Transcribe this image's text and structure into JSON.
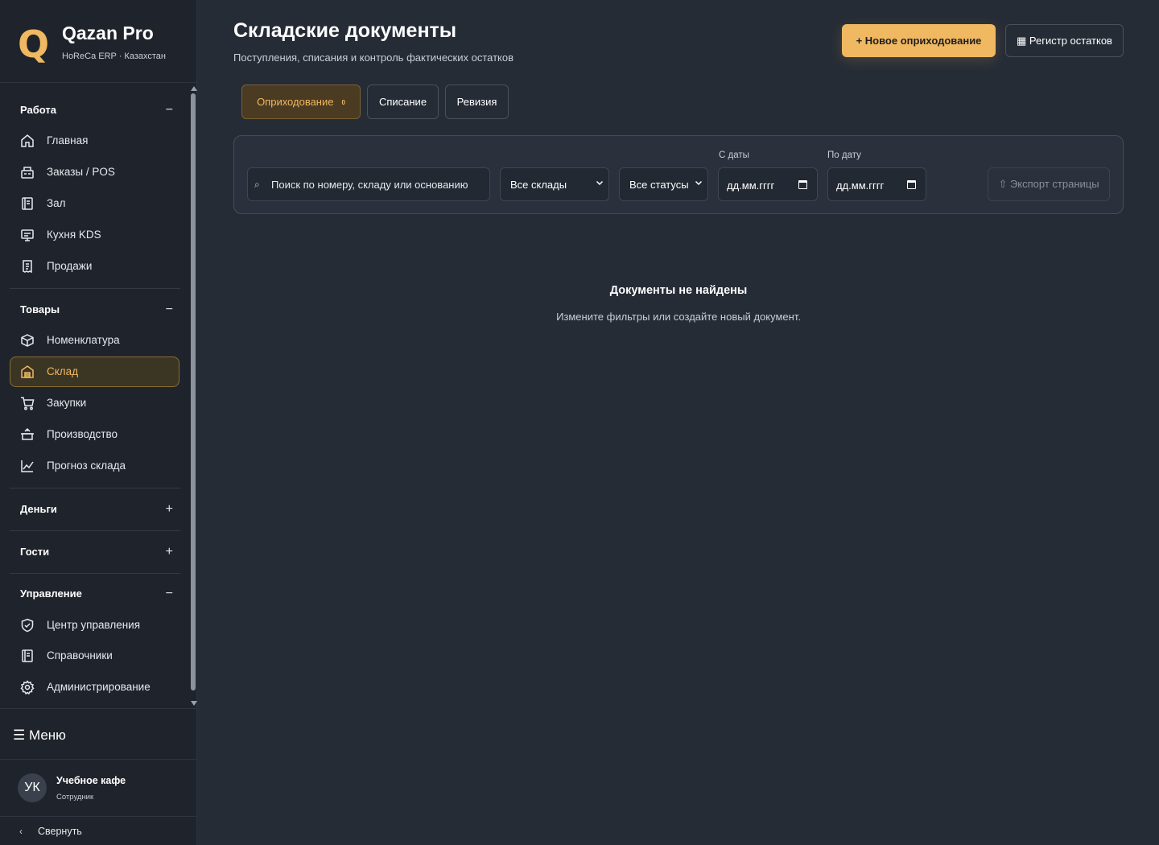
{
  "brand": {
    "logo_letter": "Q",
    "name": "Qazan Pro",
    "subtitle": "HoReCa ERP · Казахстан"
  },
  "sidebar": {
    "sections": [
      {
        "title": "Работа",
        "toggle": "−",
        "items": [
          {
            "label": "Главная",
            "icon": "home-icon"
          },
          {
            "label": "Заказы / POS",
            "icon": "register-icon"
          },
          {
            "label": "Зал",
            "icon": "book-icon"
          },
          {
            "label": "Кухня KDS",
            "icon": "monitor-icon"
          },
          {
            "label": "Продажи",
            "icon": "receipt-icon"
          }
        ]
      },
      {
        "title": "Товары",
        "toggle": "−",
        "items": [
          {
            "label": "Номенклатура",
            "icon": "box-icon"
          },
          {
            "label": "Склад",
            "icon": "warehouse-icon",
            "active": true
          },
          {
            "label": "Закупки",
            "icon": "cart-icon"
          },
          {
            "label": "Производство",
            "icon": "pot-icon"
          },
          {
            "label": "Прогноз склада",
            "icon": "chart-line-icon"
          }
        ]
      },
      {
        "title": "Деньги",
        "toggle": "+"
      },
      {
        "title": "Гости",
        "toggle": "+"
      },
      {
        "title": "Управление",
        "toggle": "−",
        "items": [
          {
            "label": "Центр управления",
            "icon": "shield-icon"
          },
          {
            "label": "Справочники",
            "icon": "book-icon"
          },
          {
            "label": "Администрирование",
            "icon": "gear-icon"
          }
        ]
      }
    ],
    "menu_label": "☰ Меню",
    "user": {
      "initials": "УК",
      "name": "Учебное кафе",
      "role": "Сотрудник"
    },
    "collapse_label": "Свернуть"
  },
  "page": {
    "title": "Складские документы",
    "subtitle": "Поступления, списания и контроль фактических остатков"
  },
  "actions": {
    "new_receipt": "+ Новое оприходование",
    "stock_register": "▦ Регистр остатков"
  },
  "tabs": [
    {
      "label": "Оприходование",
      "badge": "0",
      "active": true
    },
    {
      "label": "Списание"
    },
    {
      "label": "Ревизия"
    }
  ],
  "filters": {
    "search_placeholder": "Поиск по номеру, складу или основанию",
    "warehouse": "Все склады",
    "status": "Все статусы",
    "date_from_label": "С даты",
    "date_from": "дд.мм.гггг",
    "date_to_label": "По дату",
    "date_to": "дд.мм.гггг",
    "export": "⇧ Экспорт страницы"
  },
  "empty": {
    "title": "Документы не найдены",
    "text": "Измените фильтры или создайте новый документ."
  },
  "colors": {
    "accent": "#f0b860",
    "background": "#262c36",
    "sidebar": "#1f242c"
  }
}
